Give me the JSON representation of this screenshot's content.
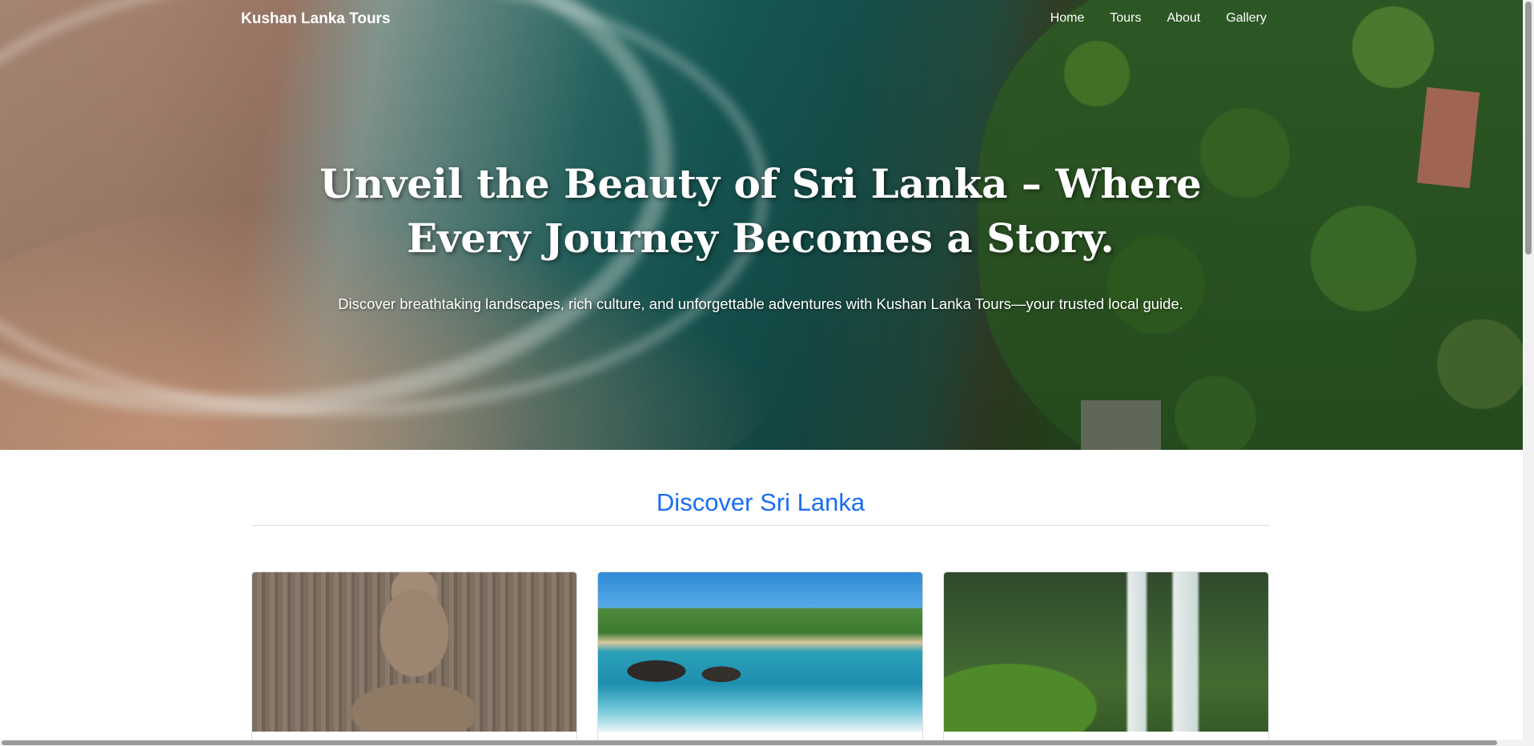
{
  "navbar": {
    "brand": "Kushan Lanka Tours",
    "links": [
      {
        "label": "Home"
      },
      {
        "label": "Tours"
      },
      {
        "label": "About"
      },
      {
        "label": "Gallery"
      }
    ]
  },
  "hero": {
    "title": "Unveil the Beauty of Sri Lanka – Where Every Journey Becomes a Story.",
    "subtitle": "Discover breathtaking landscapes, rich culture, and unforgettable adventures with Kushan Lanka Tours—your trusted local guide."
  },
  "section": {
    "title": "Discover Sri Lanka",
    "cards": [
      {
        "image": "buddha-statue-image"
      },
      {
        "image": "tropical-beach-image"
      },
      {
        "image": "waterfall-image"
      }
    ]
  }
}
